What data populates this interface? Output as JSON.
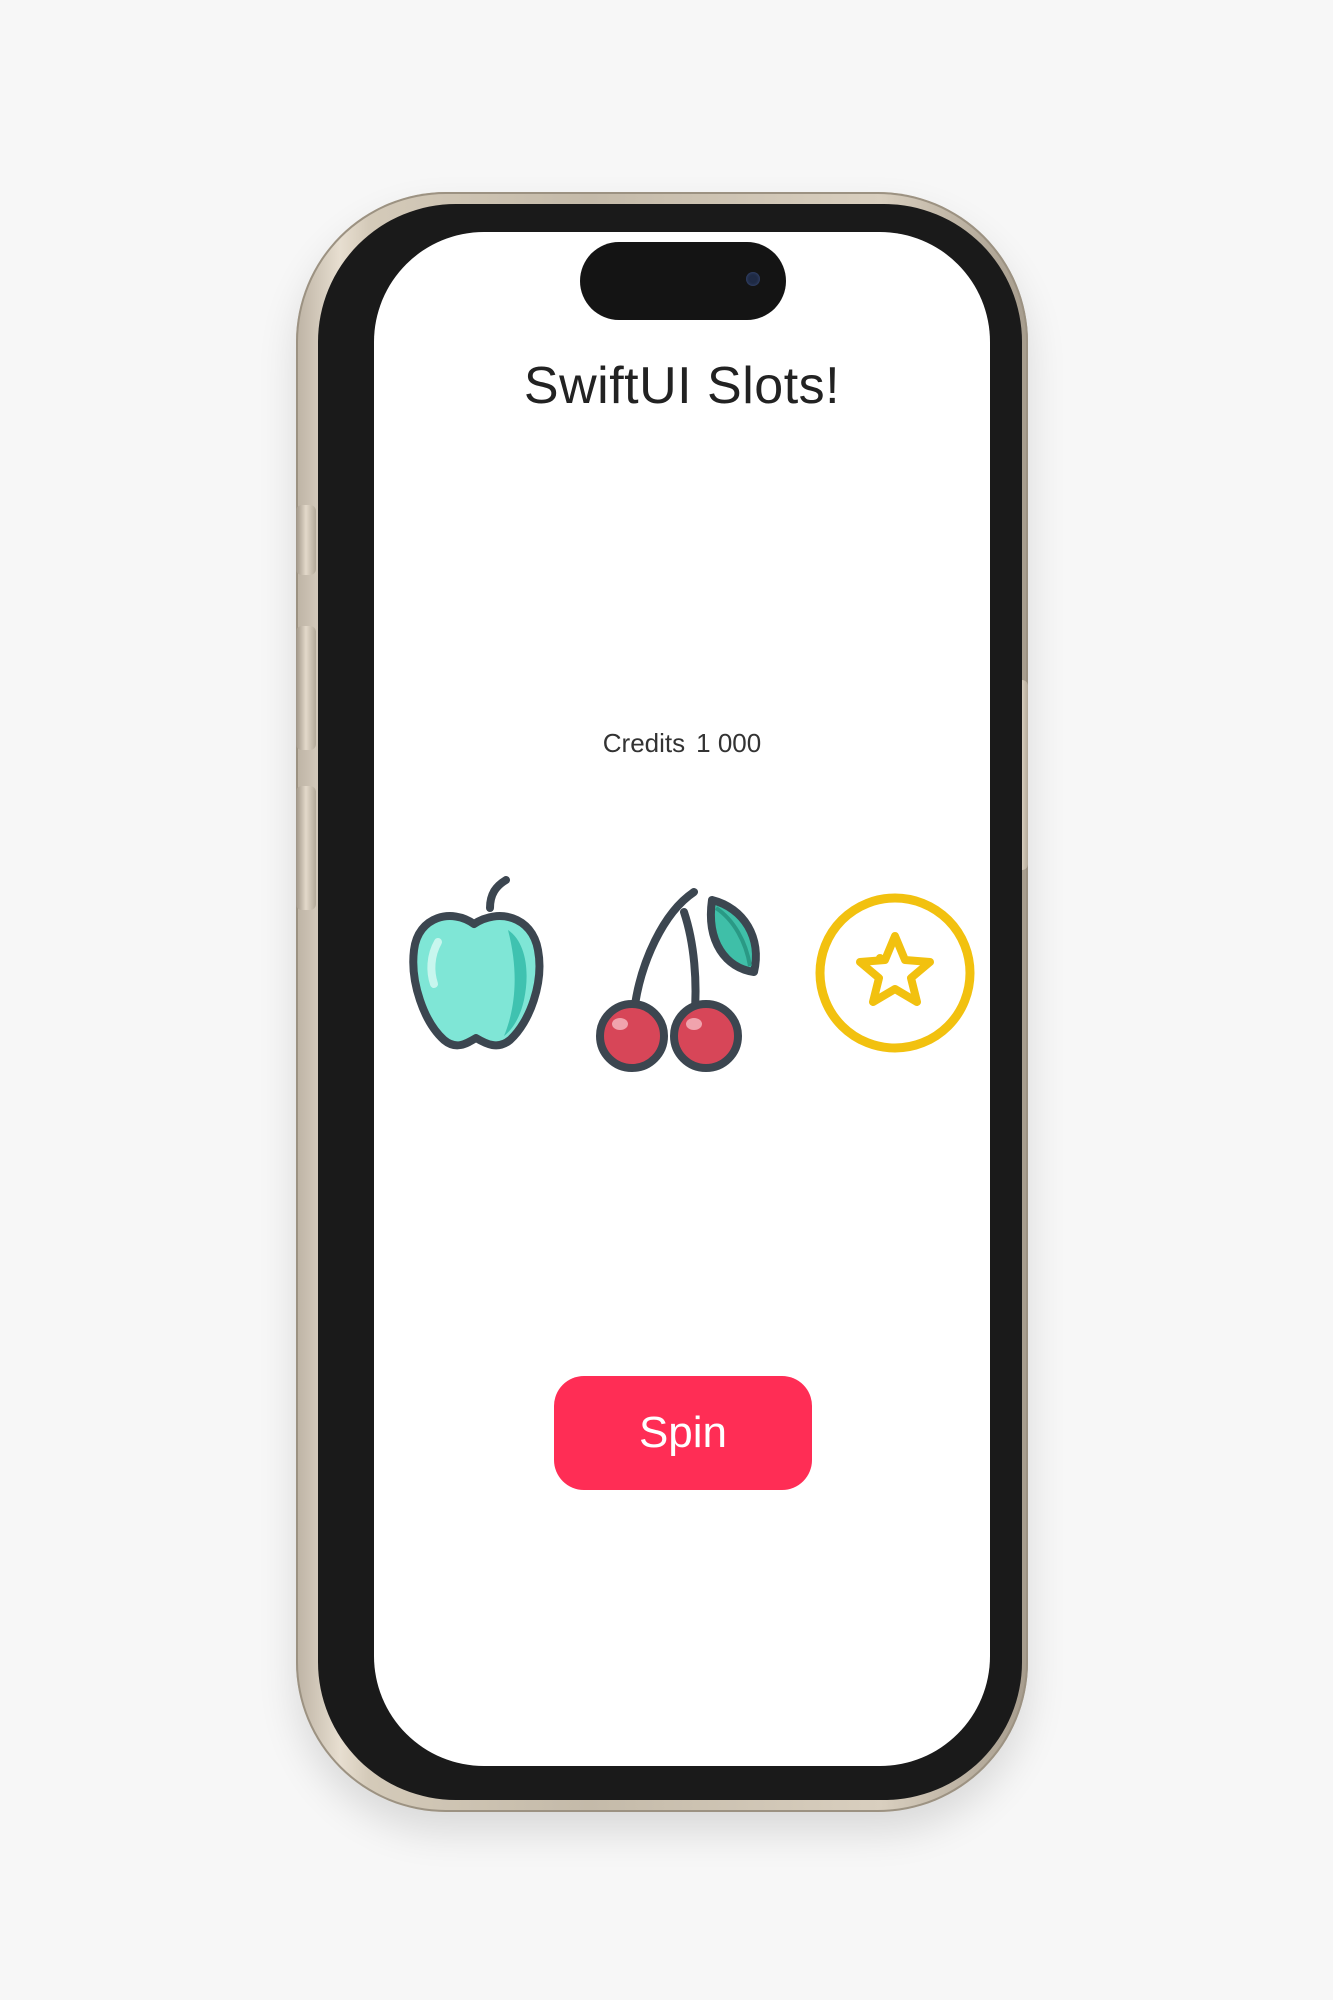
{
  "app": {
    "title": "SwiftUI Slots!",
    "credits_label": "Credits",
    "credits_value": "1 000"
  },
  "reels": [
    {
      "icon": "apple-icon",
      "color": "#7fe3d3"
    },
    {
      "icon": "cherry-icon",
      "color": "#d94657"
    },
    {
      "icon": "star-icon",
      "color": "#f2c10f"
    }
  ],
  "controls": {
    "spin_label": "Spin",
    "spin_color": "#ff2d55"
  }
}
